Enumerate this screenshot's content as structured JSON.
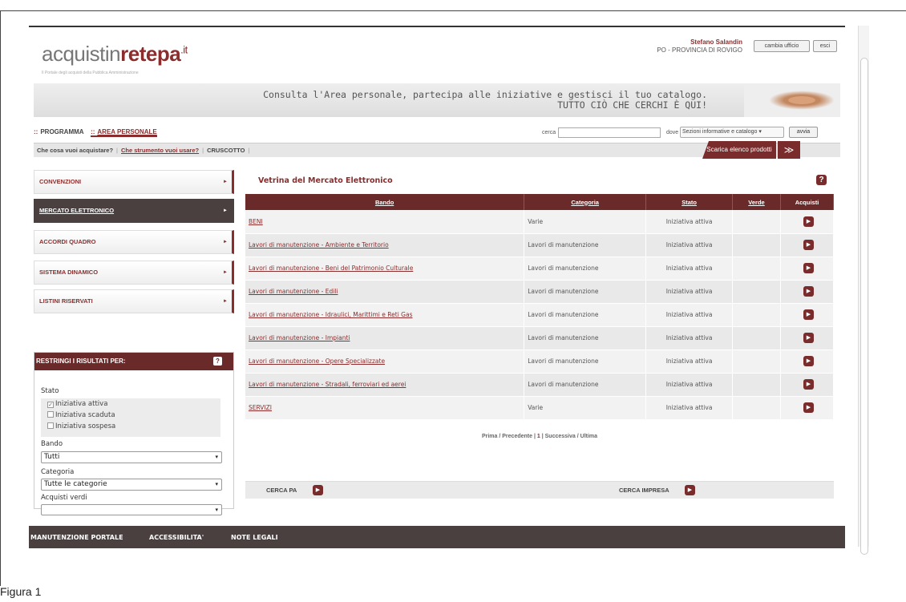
{
  "header": {
    "logo": {
      "part1": "acquistin",
      "part2": "retepa",
      "suffix": ".it"
    },
    "logo_subtitle": "Il Portale degli acquisti della Pubblica Amministrazione",
    "user_name": "Stefano Salandin",
    "user_office": "PO - PROVINCIA DI ROVIGO",
    "buttons": {
      "change_office": "cambia ufficio",
      "logout": "esci"
    }
  },
  "banner": {
    "line1": "Consulta l'Area personale, partecipa alle iniziative e gestisci il tuo catalogo.",
    "line2": "TUTTO CIÒ CHE CERCHI È QUI!"
  },
  "nav": {
    "tabs": [
      {
        "dots": "::",
        "label": "PROGRAMMA"
      },
      {
        "dots": "::",
        "label": "AREA PERSONALE"
      }
    ],
    "search_label": "cerca",
    "search_value": "",
    "dove_label": "dove",
    "dove_selected": "Sezioni informative e catalogo",
    "go_button": "avvia",
    "secondary": {
      "item1": "Che cosa vuoi acquistare?",
      "item2": "Che strumento vuoi usare?",
      "item3": "CRUSCOTTO",
      "sep": "|"
    },
    "download_button": "Scarica elenco prodotti",
    "toggle_icon": "≫"
  },
  "sidebar": {
    "items": [
      {
        "label": "CONVENZIONI"
      },
      {
        "label": "MERCATO ELETTRONICO"
      },
      {
        "label": "ACCORDI QUADRO"
      },
      {
        "label": "SISTEMA DINAMICO"
      },
      {
        "label": "LISTINI RISERVATI"
      }
    ],
    "arrow": "►"
  },
  "filters": {
    "title": "RESTRINGI I RISULTATI PER:",
    "help": "?",
    "stato_label": "Stato",
    "stato_options": [
      {
        "label": "Iniziativa attiva",
        "checked": "✓"
      },
      {
        "label": "Iniziativa scaduta",
        "checked": ""
      },
      {
        "label": "Iniziativa sospesa",
        "checked": ""
      }
    ],
    "bando_label": "Bando",
    "bando_value": "Tutti",
    "categoria_label": "Categoria",
    "categoria_value": "Tutte le categorie",
    "verdi_label": "Acquisti verdi",
    "verdi_value": "",
    "caret": "▾"
  },
  "main": {
    "title": "Vetrina del Mercato Elettronico",
    "help": "?",
    "columns": [
      "Bando",
      "Categoria",
      "Stato",
      "Verde",
      "Acquisti"
    ],
    "rows": [
      {
        "bando": "BENI",
        "categoria": "Varie",
        "stato": "Iniziativa attiva",
        "verde": ""
      },
      {
        "bando": "Lavori di manutenzione - Ambiente e Territorio",
        "categoria": "Lavori di manutenzione",
        "stato": "Iniziativa attiva",
        "verde": ""
      },
      {
        "bando": "Lavori di manutenzione - Beni del Patrimonio Culturale",
        "categoria": "Lavori di manutenzione",
        "stato": "Iniziativa attiva",
        "verde": ""
      },
      {
        "bando": "Lavori di manutenzione - Edili",
        "categoria": "Lavori di manutenzione",
        "stato": "Iniziativa attiva",
        "verde": ""
      },
      {
        "bando": "Lavori di manutenzione - Idraulici, Marittimi e Reti Gas",
        "categoria": "Lavori di manutenzione",
        "stato": "Iniziativa attiva",
        "verde": ""
      },
      {
        "bando": "Lavori di manutenzione - Impianti",
        "categoria": "Lavori di manutenzione",
        "stato": "Iniziativa attiva",
        "verde": ""
      },
      {
        "bando": "Lavori di manutenzione - Opere Specializzate",
        "categoria": "Lavori di manutenzione",
        "stato": "Iniziativa attiva",
        "verde": ""
      },
      {
        "bando": "Lavori di manutenzione - Stradali, ferroviari ed aerei",
        "categoria": "Lavori di manutenzione",
        "stato": "Iniziativa attiva",
        "verde": ""
      },
      {
        "bando": "SERVIZI",
        "categoria": "Varie",
        "stato": "Iniziativa attiva",
        "verde": ""
      }
    ],
    "go_icon": "▶",
    "pager": {
      "first": "Prima",
      "prev": "Precedente",
      "current": "1",
      "next": "Successiva",
      "last": "Ultima"
    },
    "cerca_pa": "CERCA PA",
    "cerca_impresa": "CERCA IMPRESA"
  },
  "footer": {
    "items": [
      "MANUTENZIONE PORTALE",
      "ACCESSIBILITA'",
      "NOTE LEGALI"
    ]
  },
  "caption": "Figura 1"
}
